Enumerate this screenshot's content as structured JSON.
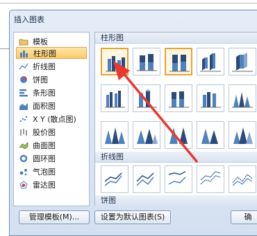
{
  "dialog": {
    "title": "插入图表",
    "chart_types": [
      {
        "label": "模板",
        "icon": "folder-icon"
      },
      {
        "label": "柱形图",
        "icon": "column-chart-icon",
        "selected": true
      },
      {
        "label": "折线图",
        "icon": "line-chart-icon"
      },
      {
        "label": "饼图",
        "icon": "pie-chart-icon"
      },
      {
        "label": "条形图",
        "icon": "bar-chart-icon"
      },
      {
        "label": "面积图",
        "icon": "area-chart-icon"
      },
      {
        "label": "X Y (散点图)",
        "icon": "scatter-chart-icon"
      },
      {
        "label": "股价图",
        "icon": "stock-chart-icon"
      },
      {
        "label": "曲面图",
        "icon": "surface-chart-icon"
      },
      {
        "label": "圆环图",
        "icon": "doughnut-chart-icon"
      },
      {
        "label": "气泡图",
        "icon": "bubble-chart-icon"
      },
      {
        "label": "雷达图",
        "icon": "radar-chart-icon"
      }
    ],
    "sections": [
      {
        "label": "柱形图"
      },
      {
        "label": "折线图"
      },
      {
        "label": "饼图"
      }
    ],
    "buttons": {
      "manage_templates": "管理模板(M)...",
      "set_default": "设置为默认图表(S)",
      "confirm": "确"
    },
    "colors": {
      "accent_orange": "#e3a23b",
      "series_blue": "#4f81bd",
      "series_dark": "#2c4a7a",
      "arrow_red": "#e8382f"
    }
  }
}
